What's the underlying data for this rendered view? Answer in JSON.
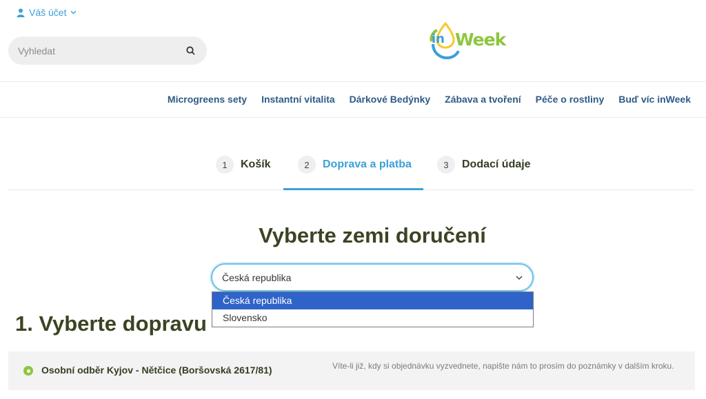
{
  "account": {
    "label": "Váš účet"
  },
  "search": {
    "placeholder": "Vyhledat"
  },
  "logo": {
    "prefix": "in",
    "text": "Week"
  },
  "nav": [
    "Microgreens sety",
    "Instantní vitalita",
    "Dárkové Bedýnky",
    "Zábava a tvoření",
    "Péče o rostliny",
    "Buď víc inWeek"
  ],
  "steps": [
    {
      "num": "1",
      "label": "Košík"
    },
    {
      "num": "2",
      "label": "Doprava a platba"
    },
    {
      "num": "3",
      "label": "Dodací údaje"
    }
  ],
  "country": {
    "title": "Vyberte zemi doručení",
    "selected": "Česká republika",
    "options": [
      "Česká republika",
      "Slovensko"
    ]
  },
  "shipping": {
    "title": "1. Vyberte dopravu",
    "option_name": "Osobní odběr Kyjov - Nětčice (Boršovská 2617/81)",
    "option_note": "Víte-li již, kdy si objednávku vyzvednete, napište nám to prosím do poznámky v dalším kroku."
  },
  "colors": {
    "accent_blue": "#3aa0d8",
    "accent_green": "#8dc63f",
    "nav_blue": "#2e5a86",
    "dropdown_selected": "#2f63c9"
  },
  "icons": {
    "account": "user-icon",
    "search": "search-icon",
    "chevron": "chevron-down-icon",
    "radio": "radio-selected-icon"
  }
}
